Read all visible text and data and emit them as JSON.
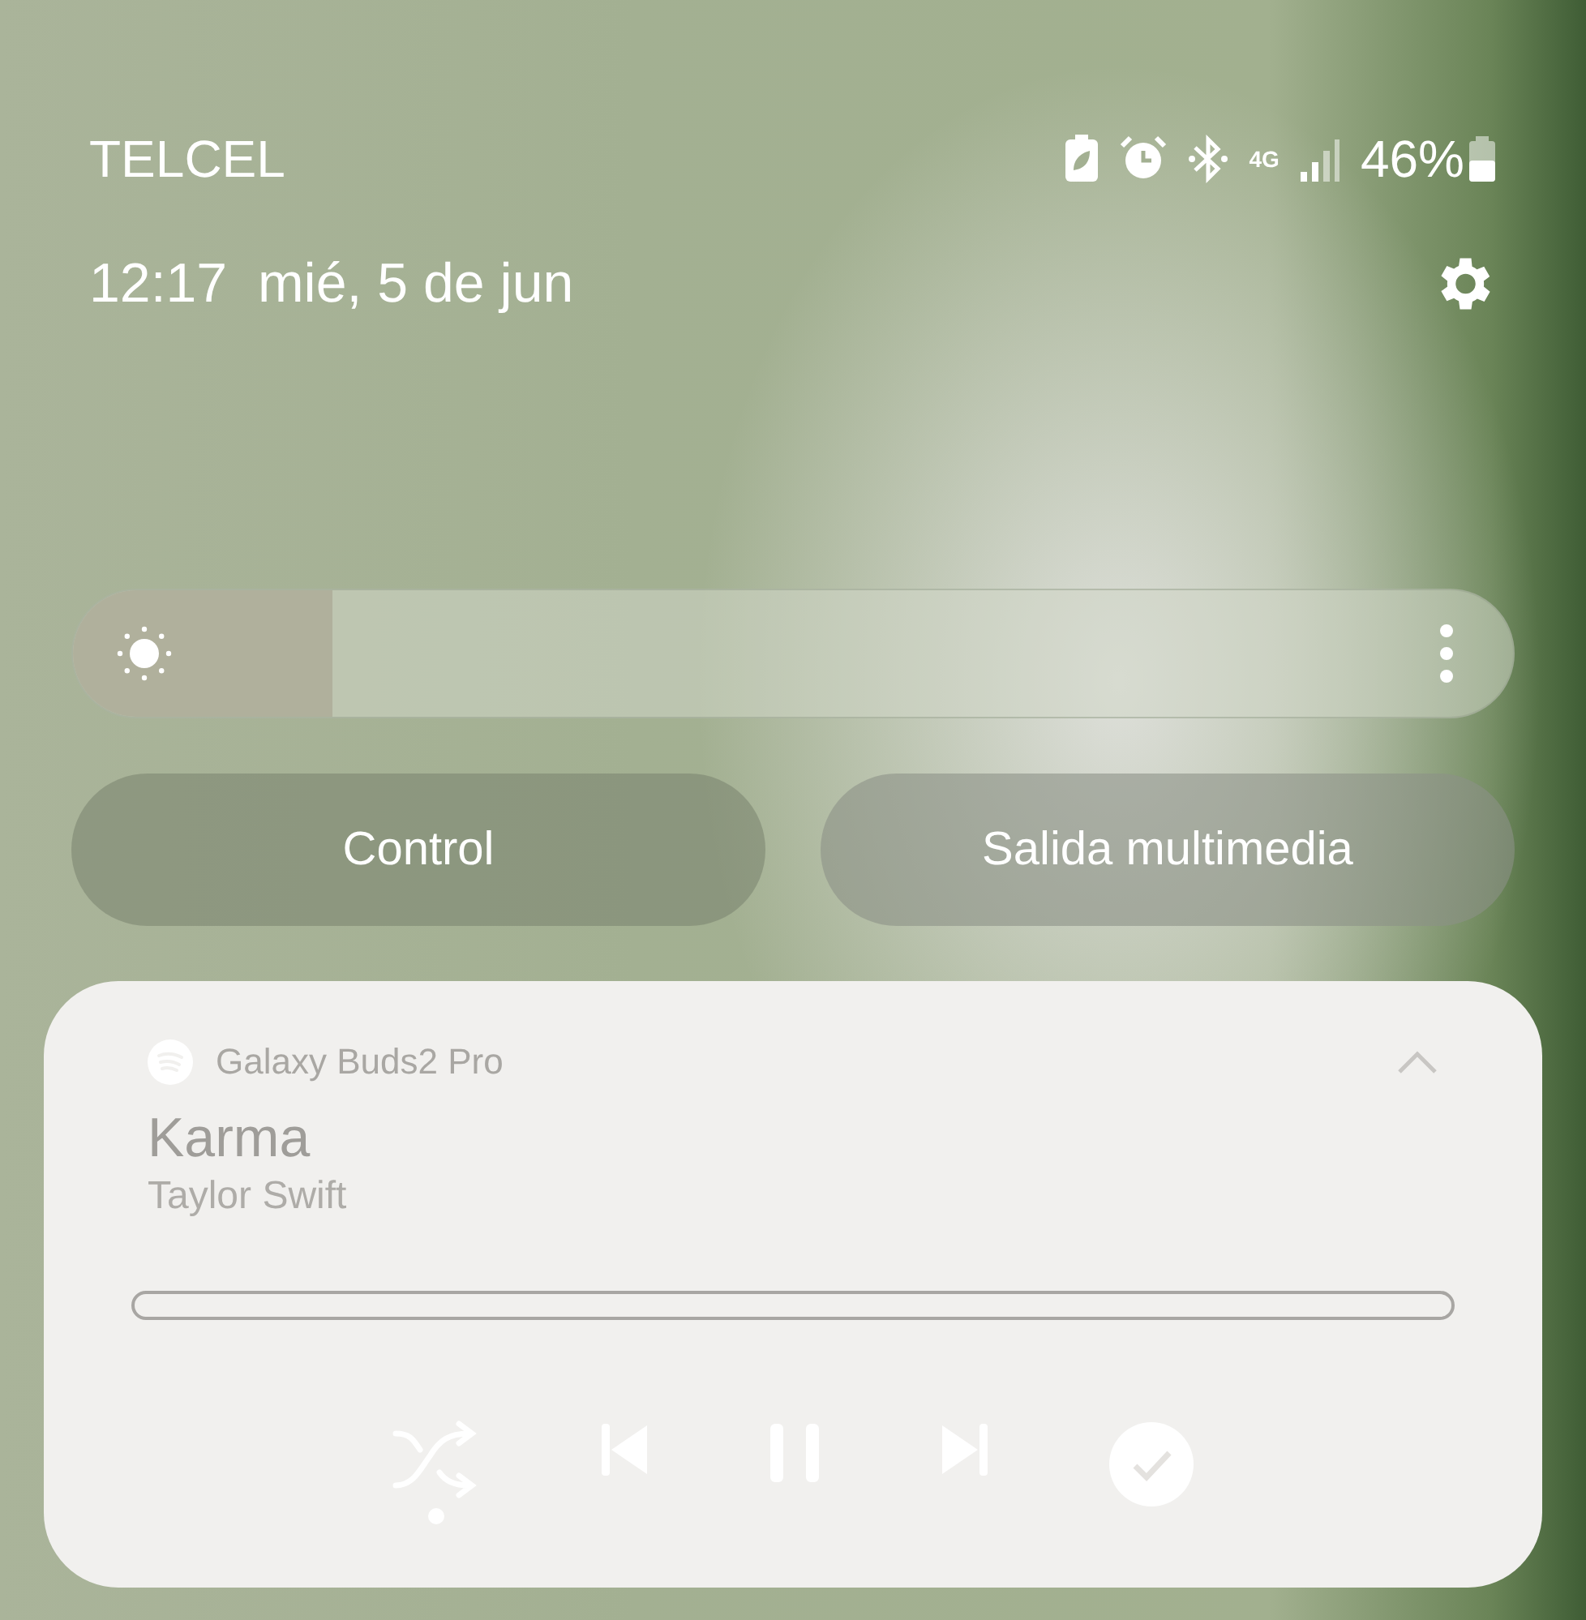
{
  "status_bar": {
    "carrier": "TELCEL",
    "network": "4G",
    "battery": "46%"
  },
  "header": {
    "time": "12:17",
    "date": "mié, 5 de jun"
  },
  "brightness": {
    "level": 0.18
  },
  "buttons": [
    {
      "label": "Control"
    },
    {
      "label": "Salida multimedia"
    }
  ],
  "media": {
    "device": "Galaxy Buds2 Pro",
    "title": "Karma",
    "artist": "Taylor Swift",
    "shuffle_on": true,
    "expanded": true
  }
}
